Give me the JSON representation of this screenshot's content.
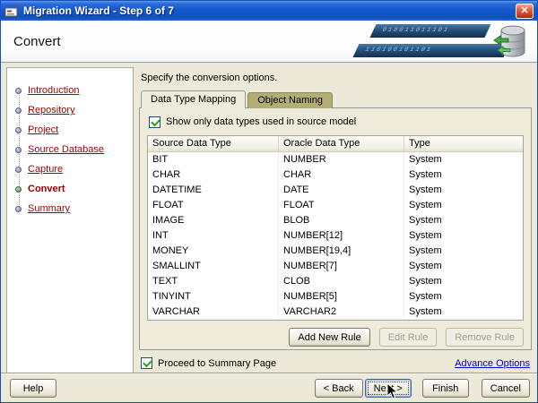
{
  "window": {
    "title": "Migration Wizard - Step 6 of 7"
  },
  "icons": {
    "close": "✕"
  },
  "header": {
    "title": "Convert",
    "binary1": "010011011101",
    "binary2": "110100101101"
  },
  "sidebar": {
    "steps": [
      "Introduction",
      "Repository",
      "Project",
      "Source Database",
      "Capture",
      "Convert",
      "Summary"
    ]
  },
  "main": {
    "instruction": "Specify the conversion options.",
    "tabs": [
      {
        "label": "Data Type Mapping"
      },
      {
        "label": "Object Naming"
      }
    ],
    "show_only_label": "Show only data types used in source model",
    "table": {
      "columns": [
        "Source Data Type",
        "Oracle Data Type",
        "Type"
      ],
      "rows": [
        [
          "BIT",
          "NUMBER",
          "System"
        ],
        [
          "CHAR",
          "CHAR",
          "System"
        ],
        [
          "DATETIME",
          "DATE",
          "System"
        ],
        [
          "FLOAT",
          "FLOAT",
          "System"
        ],
        [
          "IMAGE",
          "BLOB",
          "System"
        ],
        [
          "INT",
          "NUMBER[12]",
          "System"
        ],
        [
          "MONEY",
          "NUMBER[19,4]",
          "System"
        ],
        [
          "SMALLINT",
          "NUMBER[7]",
          "System"
        ],
        [
          "TEXT",
          "CLOB",
          "System"
        ],
        [
          "TINYINT",
          "NUMBER[5]",
          "System"
        ],
        [
          "VARCHAR",
          "VARCHAR2",
          "System"
        ]
      ]
    },
    "buttons": {
      "add": "Add New Rule",
      "edit": "Edit Rule",
      "remove": "Remove Rule"
    },
    "proceed_label": "Proceed to Summary Page",
    "advance_options": "Advance Options"
  },
  "footer": {
    "help": "Help",
    "back": "< Back",
    "next": "Next >",
    "finish": "Finish",
    "cancel": "Cancel"
  }
}
